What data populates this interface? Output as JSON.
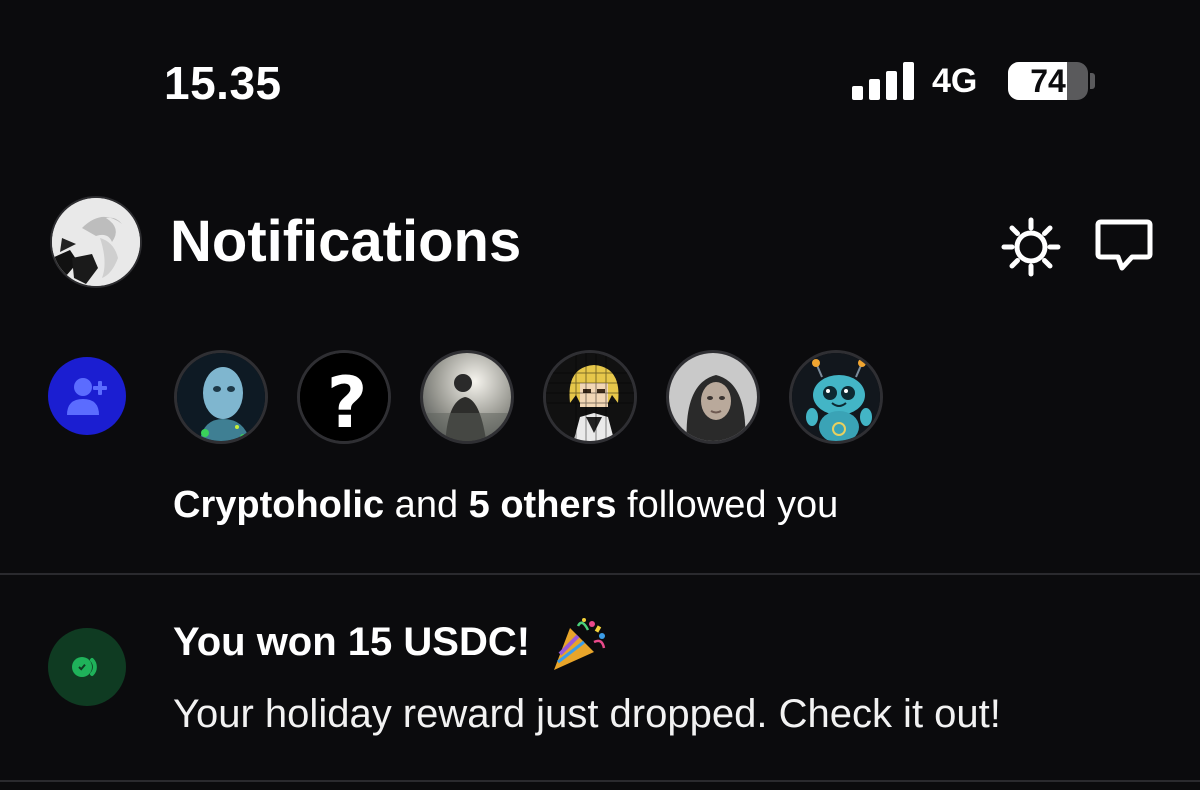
{
  "status_bar": {
    "time": "15.35",
    "network": "4G",
    "battery_percent": "74",
    "battery_level": 0.74,
    "signal_bars": 4
  },
  "header": {
    "title": "Notifications",
    "icons": [
      "profile-avatar",
      "gear-icon",
      "chat-bubble-icon"
    ]
  },
  "follow_notification": {
    "icon": "add-user-icon",
    "follower_avatars": [
      "robot-portrait",
      "question-mark",
      "silhouette-sky",
      "pixel-anime-character",
      "person-hijab",
      "cute-blue-creature"
    ],
    "name": "Cryptoholic",
    "connector": " and ",
    "others": "5 others",
    "suffix": " followed you"
  },
  "reward_notification": {
    "icon": "reward-coin-icon",
    "title": "You won 15 USDC!",
    "emoji": "party-popper-icon",
    "body": "Your holiday reward just dropped. Check it out!"
  },
  "colors": {
    "background": "#0b0b0d",
    "follow_badge": "#1b1ed1",
    "reward_badge": "#0f3b22",
    "reward_accent": "#1fb25a",
    "divider": "#2a2a2e"
  }
}
